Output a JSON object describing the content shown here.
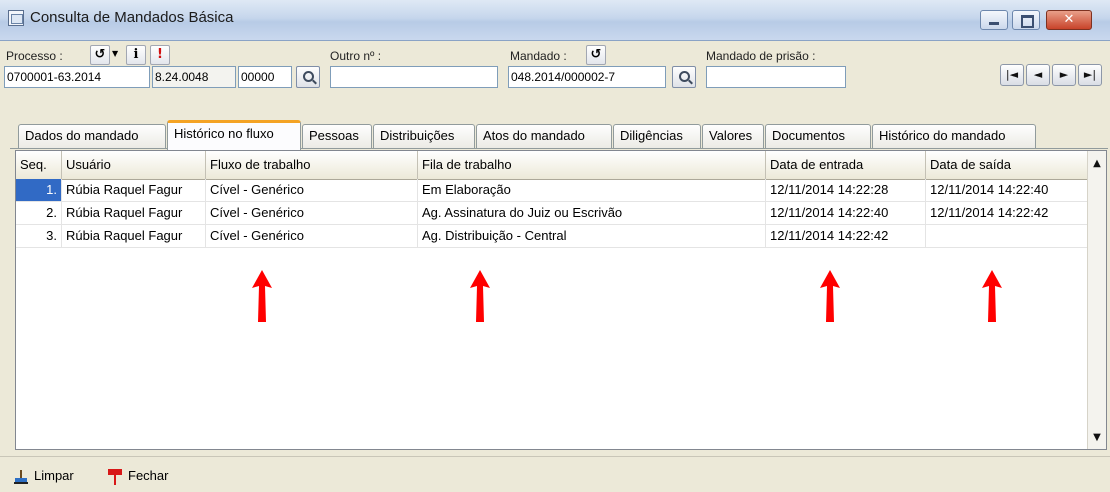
{
  "window": {
    "title": "Consulta de Mandados Básica"
  },
  "form": {
    "processo_label": "Processo :",
    "processo_part1": "0700001-63.2014",
    "processo_part2": "8.24.0048",
    "processo_part3": "00000",
    "outro_label": "Outro nº :",
    "outro_value": "",
    "mandado_label": "Mandado :",
    "mandado_value": "048.2014/000002-7",
    "prisao_label": "Mandado de prisão :",
    "prisao_value": "",
    "info_glyph": "i",
    "alert_glyph": "!"
  },
  "nav": [
    "|◄",
    "◄",
    "►",
    "►|"
  ],
  "tabs": [
    {
      "label": "Dados do mandado",
      "active": false
    },
    {
      "label": "Histórico no fluxo",
      "active": true
    },
    {
      "label": "Pessoas",
      "active": false
    },
    {
      "label": "Distribuições",
      "active": false
    },
    {
      "label": "Atos do mandado",
      "active": false
    },
    {
      "label": "Diligências",
      "active": false
    },
    {
      "label": "Valores",
      "active": false
    },
    {
      "label": "Documentos",
      "active": false
    },
    {
      "label": "Histórico do mandado",
      "active": false
    }
  ],
  "grid": {
    "columns": [
      "Seq.",
      "Usuário",
      "Fluxo de trabalho",
      "Fila de trabalho",
      "Data de entrada",
      "Data de saída"
    ],
    "rows": [
      {
        "seq": "1.",
        "usuario": "Rúbia Raquel Fagur",
        "fluxo": "Cível - Genérico",
        "fila": "Em Elaboração",
        "entrada": "12/11/2014 14:22:28",
        "saida": "12/11/2014 14:22:40"
      },
      {
        "seq": "2.",
        "usuario": "Rúbia Raquel Fagur",
        "fluxo": "Cível - Genérico",
        "fila": "Ag. Assinatura do Juiz ou Escrivão",
        "entrada": "12/11/2014 14:22:40",
        "saida": "12/11/2014 14:22:42"
      },
      {
        "seq": "3.",
        "usuario": "Rúbia Raquel Fagur",
        "fluxo": "Cível - Genérico",
        "fila": "Ag. Distribuição - Central",
        "entrada": "12/11/2014 14:22:42",
        "saida": ""
      }
    ],
    "selected_row": 0
  },
  "footer": {
    "limpar": "Limpar",
    "fechar": "Fechar"
  },
  "colors": {
    "annotation_arrow": "#ff0000",
    "selection": "#316ac5",
    "active_tab_accent": "#f4a324"
  }
}
